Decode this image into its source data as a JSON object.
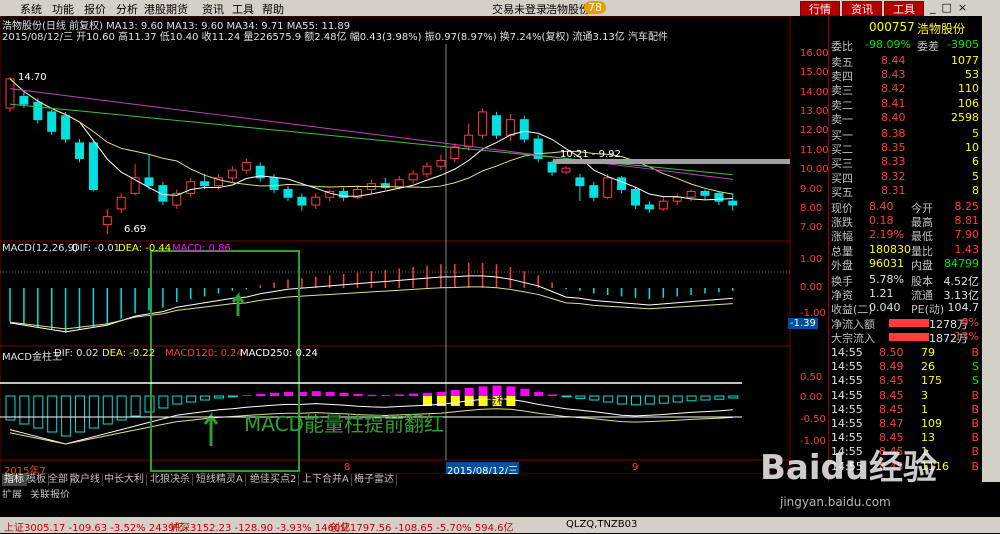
{
  "menu": [
    "系统",
    "功能",
    "报价",
    "分析",
    "港股期货",
    "资讯",
    "工具",
    "帮助"
  ],
  "menu_right": {
    "login": "交易未登录",
    "stock": "浩物股份",
    "badge": "78"
  },
  "top_buttons": [
    "行情",
    "资讯",
    "工具"
  ],
  "header": {
    "line1": "浩物股份(日线 前复权) MA13: 9.60  MA13: 9.60  MA34: 9.71  MA55: 11.89",
    "line2": "2015/08/12/三 开10.60 高11.37 低10.40 收11.24 量226575.9 额2.48亿 幅0.43(3.98%) 振0.97(8.97%) 换7.24%(复权) 流通3.13亿 汽车配件"
  },
  "price_axis": [
    "16.00",
    "15.00",
    "14.00",
    "13.00",
    "12.00",
    "11.00",
    "10.00",
    "9.00",
    "8.00",
    "7.00"
  ],
  "price_annot": {
    "high": "14.70",
    "low": "6.69",
    "range": "10.21 - 9.92"
  },
  "macd1": {
    "label": "MACD(12,26,9)",
    "dif": "DIF: -0.01",
    "dea": "DEA: -0.44",
    "macd": "MACD: 0.86",
    "axis": [
      "1.00",
      "0.00",
      "-1.00"
    ],
    "marker": "-1.39"
  },
  "macd2": {
    "label": "MACD金柱王",
    "dif": "DIF: 0.02",
    "dea": "DEA: -0.22",
    "m120": "MACD120: 0.24",
    "m250": "MACD250: 0.24",
    "axis": [
      "0.50",
      "0.00",
      "-0.50",
      "-1.00"
    ],
    "annot": "MACD能量柱提前翻红",
    "tag": "金柱"
  },
  "date_axis": [
    "2015年7",
    "8",
    "2015/08/12/三",
    "9"
  ],
  "tabs": [
    "指标",
    "模板",
    "全部",
    "散户线",
    "中长大利",
    "北狼决杀",
    "短线精灵A",
    "绝佳买点2",
    "上下合并A",
    "梅子雷达"
  ],
  "tabs2": [
    "扩展",
    "关联报价"
  ],
  "quote": {
    "code": "000757",
    "name": "浩物股份",
    "wb_label": "委比",
    "wb": "-98.09%",
    "wc_label": "委差",
    "wc": "-3905",
    "asks": [
      {
        "l": "卖五",
        "p": "8.44",
        "v": "1077"
      },
      {
        "l": "卖四",
        "p": "8.43",
        "v": "53"
      },
      {
        "l": "卖三",
        "p": "8.42",
        "v": "110"
      },
      {
        "l": "卖二",
        "p": "8.41",
        "v": "106"
      },
      {
        "l": "卖一",
        "p": "8.40",
        "v": "2598"
      }
    ],
    "bids": [
      {
        "l": "买一",
        "p": "8.38",
        "v": "5"
      },
      {
        "l": "买二",
        "p": "8.35",
        "v": "10"
      },
      {
        "l": "买三",
        "p": "8.33",
        "v": "6"
      },
      {
        "l": "买四",
        "p": "8.32",
        "v": "5"
      },
      {
        "l": "买五",
        "p": "8.31",
        "v": "8"
      }
    ],
    "stats": [
      {
        "a": "现价",
        "av": "8.40",
        "b": "今开",
        "bv": "8.25"
      },
      {
        "a": "涨跌",
        "av": "0.18",
        "b": "最高",
        "bv": "8.81"
      },
      {
        "a": "涨幅",
        "av": "2.19%",
        "b": "最低",
        "bv": "7.90"
      },
      {
        "a": "总量",
        "av": "180830",
        "b": "量比",
        "bv": "1.43"
      },
      {
        "a": "外盘",
        "av": "96031",
        "b": "内盘",
        "bv": "84799"
      }
    ],
    "stats2": [
      {
        "a": "换手",
        "av": "5.78%",
        "b": "股本",
        "bv": "4.52亿"
      },
      {
        "a": "净资",
        "av": "1.21",
        "b": "流通",
        "bv": "3.13亿"
      },
      {
        "a": "收益(二)",
        "av": "0.040",
        "b": "PE(动)",
        "bv": "104.7"
      }
    ],
    "flows": [
      {
        "l": "净流入额",
        "v": "1278万",
        "p": "9%"
      },
      {
        "l": "大宗流入",
        "v": "1872万",
        "p": "13%"
      }
    ],
    "ticks": [
      {
        "t": "14:55",
        "p": "8.50",
        "v": "79",
        "s": "B"
      },
      {
        "t": "14:55",
        "p": "8.49",
        "v": "26",
        "s": "S"
      },
      {
        "t": "14:55",
        "p": "8.45",
        "v": "175",
        "s": "S"
      },
      {
        "t": "14:55",
        "p": "8.45",
        "v": "3",
        "s": "B"
      },
      {
        "t": "14:55",
        "p": "8.45",
        "v": "1",
        "s": "B"
      },
      {
        "t": "14:55",
        "p": "8.47",
        "v": "109",
        "s": "B"
      },
      {
        "t": "14:55",
        "p": "8.45",
        "v": "13",
        "s": "B"
      },
      {
        "t": "14:55",
        "p": "8.45",
        "v": "1",
        "s": "B"
      },
      {
        "t": "14:55",
        "p": "8.45",
        "v": "1116",
        "s": "B"
      }
    ]
  },
  "status": {
    "sh": "上证3005.17 -109.63 -3.52% 2439亿",
    "sz": "沪深3152.23 -128.90 -3.93% 1460亿",
    "cy": "创业1797.56 -108.65 -5.70% 594.6亿",
    "code": "QLZQ,TNZB03"
  },
  "watermark": {
    "logo": "Baidu经验",
    "url": "jingyan.baidu.com"
  },
  "chart_data": {
    "type": "candlestick",
    "ylim": [
      6.5,
      16.5
    ],
    "candles": [
      {
        "o": 13.2,
        "c": 14.7,
        "h": 14.8,
        "l": 13.0
      },
      {
        "o": 13.8,
        "c": 13.4,
        "h": 14.0,
        "l": 13.2
      },
      {
        "o": 13.5,
        "c": 12.6,
        "h": 13.7,
        "l": 12.4
      },
      {
        "o": 13.0,
        "c": 12.0,
        "h": 13.1,
        "l": 11.8
      },
      {
        "o": 12.8,
        "c": 11.6,
        "h": 13.0,
        "l": 11.4
      },
      {
        "o": 11.4,
        "c": 10.6,
        "h": 11.6,
        "l": 10.4
      },
      {
        "o": 11.4,
        "c": 9.0,
        "h": 11.5,
        "l": 8.9
      },
      {
        "o": 7.2,
        "c": 7.6,
        "h": 8.0,
        "l": 6.69
      },
      {
        "o": 8.0,
        "c": 8.6,
        "h": 8.8,
        "l": 7.8
      },
      {
        "o": 8.8,
        "c": 9.6,
        "h": 10.3,
        "l": 8.7
      },
      {
        "o": 9.6,
        "c": 9.2,
        "h": 10.8,
        "l": 9.0
      },
      {
        "o": 9.2,
        "c": 8.4,
        "h": 9.4,
        "l": 8.2
      },
      {
        "o": 8.2,
        "c": 8.8,
        "h": 9.0,
        "l": 8.0
      },
      {
        "o": 8.8,
        "c": 9.4,
        "h": 9.6,
        "l": 8.6
      },
      {
        "o": 9.4,
        "c": 9.2,
        "h": 9.8,
        "l": 9.0
      },
      {
        "o": 9.2,
        "c": 9.6,
        "h": 9.8,
        "l": 9.0
      },
      {
        "o": 9.6,
        "c": 10.0,
        "h": 10.2,
        "l": 9.4
      },
      {
        "o": 10.0,
        "c": 10.4,
        "h": 10.6,
        "l": 9.8
      },
      {
        "o": 10.2,
        "c": 9.6,
        "h": 10.4,
        "l": 9.4
      },
      {
        "o": 9.6,
        "c": 9.0,
        "h": 9.8,
        "l": 8.8
      },
      {
        "o": 9.0,
        "c": 8.6,
        "h": 9.2,
        "l": 8.4
      },
      {
        "o": 8.6,
        "c": 8.2,
        "h": 8.8,
        "l": 7.9
      },
      {
        "o": 8.2,
        "c": 8.6,
        "h": 8.8,
        "l": 8.0
      },
      {
        "o": 8.6,
        "c": 8.9,
        "h": 9.0,
        "l": 8.4
      },
      {
        "o": 8.9,
        "c": 8.6,
        "h": 9.1,
        "l": 8.4
      },
      {
        "o": 8.6,
        "c": 9.0,
        "h": 9.2,
        "l": 8.5
      },
      {
        "o": 9.0,
        "c": 9.3,
        "h": 9.5,
        "l": 8.8
      },
      {
        "o": 9.3,
        "c": 9.1,
        "h": 9.6,
        "l": 9.0
      },
      {
        "o": 9.1,
        "c": 9.5,
        "h": 9.7,
        "l": 9.0
      },
      {
        "o": 9.5,
        "c": 9.8,
        "h": 10.0,
        "l": 9.3
      },
      {
        "o": 9.8,
        "c": 10.2,
        "h": 10.4,
        "l": 9.6
      },
      {
        "o": 10.2,
        "c": 10.5,
        "h": 10.8,
        "l": 10.0
      },
      {
        "o": 10.6,
        "c": 11.2,
        "h": 11.37,
        "l": 10.4
      },
      {
        "o": 11.2,
        "c": 11.8,
        "h": 12.4,
        "l": 11.0
      },
      {
        "o": 11.8,
        "c": 13.0,
        "h": 13.2,
        "l": 11.6
      },
      {
        "o": 12.8,
        "c": 11.8,
        "h": 13.0,
        "l": 11.6
      },
      {
        "o": 11.8,
        "c": 12.6,
        "h": 12.9,
        "l": 11.5
      },
      {
        "o": 12.6,
        "c": 11.6,
        "h": 12.8,
        "l": 11.4
      },
      {
        "o": 11.6,
        "c": 10.6,
        "h": 11.8,
        "l": 10.4
      },
      {
        "o": 10.4,
        "c": 9.9,
        "h": 10.5,
        "l": 9.7
      },
      {
        "o": 9.9,
        "c": 10.1,
        "h": 10.2,
        "l": 9.8
      },
      {
        "o": 9.6,
        "c": 9.2,
        "h": 9.8,
        "l": 8.4
      },
      {
        "o": 9.2,
        "c": 8.6,
        "h": 9.4,
        "l": 8.4
      },
      {
        "o": 8.6,
        "c": 9.6,
        "h": 9.8,
        "l": 8.5
      },
      {
        "o": 9.6,
        "c": 9.0,
        "h": 9.7,
        "l": 8.8
      },
      {
        "o": 9.0,
        "c": 8.2,
        "h": 9.1,
        "l": 8.0
      },
      {
        "o": 8.2,
        "c": 8.0,
        "h": 8.4,
        "l": 7.8
      },
      {
        "o": 8.0,
        "c": 8.4,
        "h": 8.6,
        "l": 7.9
      },
      {
        "o": 8.4,
        "c": 8.6,
        "h": 8.8,
        "l": 8.2
      },
      {
        "o": 8.6,
        "c": 8.9,
        "h": 9.0,
        "l": 8.4
      },
      {
        "o": 8.9,
        "c": 8.7,
        "h": 9.0,
        "l": 8.5
      },
      {
        "o": 8.8,
        "c": 8.4,
        "h": 8.9,
        "l": 8.2
      },
      {
        "o": 8.4,
        "c": 8.2,
        "h": 8.81,
        "l": 7.9
      }
    ],
    "macd_hist": [
      -1.2,
      -1.3,
      -1.4,
      -1.5,
      -1.6,
      -1.5,
      -1.4,
      -1.3,
      -1.1,
      -0.9,
      -0.8,
      -0.7,
      -0.5,
      -0.4,
      -0.3,
      -0.2,
      -0.1,
      -0.05,
      0.1,
      0.2,
      0.3,
      0.35,
      0.4,
      0.45,
      0.5,
      0.55,
      0.6,
      0.65,
      0.7,
      0.75,
      0.8,
      0.85,
      0.86,
      0.9,
      0.9,
      0.85,
      0.75,
      0.6,
      0.45,
      0.2,
      -0.05,
      -0.1,
      -0.2,
      -0.25,
      -0.3,
      -0.35,
      -0.4,
      -0.35,
      -0.3,
      -0.25,
      -0.2,
      -0.15,
      -0.1
    ],
    "macd2_hist": [
      -0.6,
      -0.7,
      -0.8,
      -0.9,
      -1.0,
      -0.9,
      -0.8,
      -0.7,
      -0.6,
      -0.5,
      -0.4,
      -0.3,
      -0.2,
      -0.15,
      -0.1,
      -0.05,
      -0.02,
      0.02,
      0.05,
      0.08,
      0.1,
      0.1,
      0.12,
      0.1,
      0.08,
      0.05,
      0.03,
      0.02,
      0.04,
      0.06,
      0.08,
      0.1,
      0.15,
      0.2,
      0.24,
      0.26,
      0.24,
      0.18,
      0.1,
      0.04,
      -0.02,
      -0.06,
      -0.1,
      -0.15,
      -0.2,
      -0.22,
      -0.2,
      -0.18,
      -0.15,
      -0.12,
      -0.1,
      -0.08,
      -0.05
    ]
  }
}
